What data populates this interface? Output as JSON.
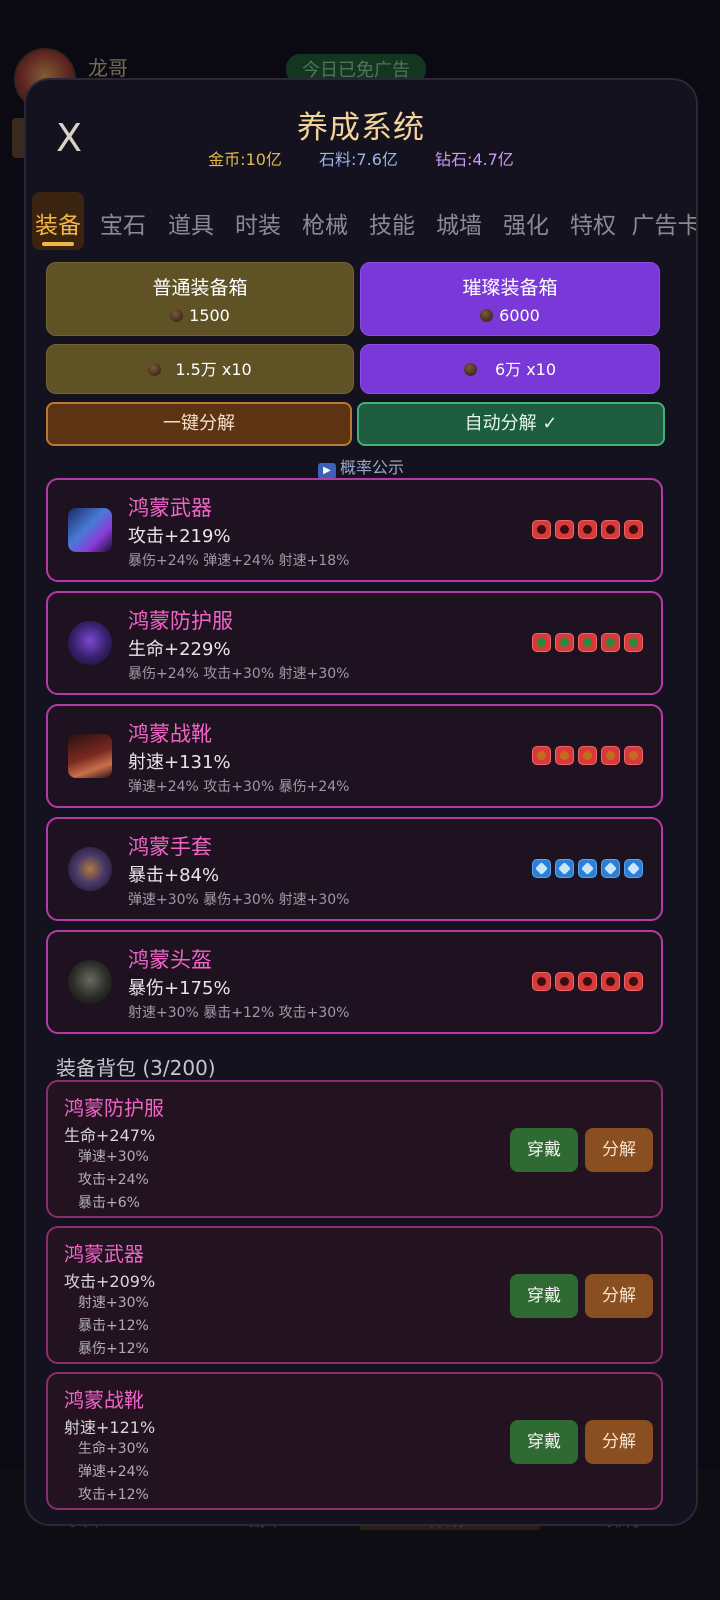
{
  "background": {
    "player_name": "龙哥",
    "ad_free": "今日已免广告",
    "nav": [
      "关卡",
      "副本",
      "养成",
      "排行"
    ]
  },
  "header": {
    "close": "X",
    "title": "养成系统",
    "gold": "金币:10亿",
    "stone": "石料:7.6亿",
    "diamond": "钻石:4.7亿",
    "menu_dots": "•••"
  },
  "tabs": [
    "装备",
    "宝石",
    "道具",
    "时装",
    "枪械",
    "技能",
    "城墙",
    "强化",
    "特权",
    "广告卡"
  ],
  "active_tab": "装备",
  "boxes": {
    "normal_name": "普通装备箱",
    "normal_price": "1500",
    "brilliant_name": "璀璨装备箱",
    "brilliant_price": "6000",
    "normal_x10": "1.5万 x10",
    "brilliant_x10": "6万 x10",
    "decompose_all": "一键分解",
    "auto_decompose": "自动分解 ✓",
    "probability": "概率公示"
  },
  "equipped": [
    {
      "name": "鸿蒙武器",
      "main": "攻击+219%",
      "sub": "暴伤+24% 弹速+24% 射速+18%",
      "gem_type": "red"
    },
    {
      "name": "鸿蒙防护服",
      "main": "生命+229%",
      "sub": "暴伤+24% 攻击+30% 射速+30%",
      "gem_type": "green"
    },
    {
      "name": "鸿蒙战靴",
      "main": "射速+131%",
      "sub": "弹速+24% 攻击+30% 暴伤+24%",
      "gem_type": "orange"
    },
    {
      "name": "鸿蒙手套",
      "main": "暴击+84%",
      "sub": "弹速+30% 暴伤+30% 射速+30%",
      "gem_type": "blue"
    },
    {
      "name": "鸿蒙头盔",
      "main": "暴伤+175%",
      "sub": "射速+30% 暴击+12% 攻击+30%",
      "gem_type": "dark"
    }
  ],
  "bag": {
    "title": "装备背包 (3/200)",
    "wear_label": "穿戴",
    "decompose_label": "分解",
    "items": [
      {
        "name": "鸿蒙防护服",
        "main": "生命+247%",
        "subs": [
          "弹速+30%",
          "攻击+24%",
          "暴击+6%"
        ]
      },
      {
        "name": "鸿蒙武器",
        "main": "攻击+209%",
        "subs": [
          "射速+30%",
          "暴击+12%",
          "暴伤+12%"
        ]
      },
      {
        "name": "鸿蒙战靴",
        "main": "射速+121%",
        "subs": [
          "生命+30%",
          "弹速+24%",
          "攻击+12%"
        ]
      }
    ]
  }
}
